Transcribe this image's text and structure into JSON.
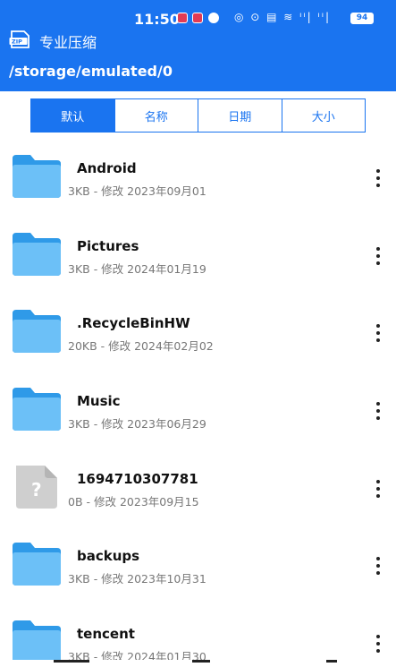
{
  "status": {
    "time": "11:50",
    "icons_text": "◎ ⊙ ▤ ≋ ᴵᴵ| ᴵᴵ|",
    "battery": "94"
  },
  "app": {
    "title": "专业压缩",
    "path": "/storage/emulated/0",
    "accent": "#1a74f0"
  },
  "sort_tabs": [
    {
      "label": "默认",
      "active": true
    },
    {
      "label": "名称",
      "active": false
    },
    {
      "label": "日期",
      "active": false
    },
    {
      "label": "大小",
      "active": false
    }
  ],
  "files": [
    {
      "name": "Android",
      "meta": "3KB - 修改 2023年09月01",
      "icon": "folder-icon"
    },
    {
      "name": "Pictures",
      "meta": "3KB - 修改 2024年01月19",
      "icon": "folder-icon"
    },
    {
      "name": ".RecycleBinHW",
      "meta": "20KB - 修改 2024年02月02",
      "icon": "folder-icon"
    },
    {
      "name": "Music",
      "meta": "3KB - 修改 2023年06月29",
      "icon": "folder-icon"
    },
    {
      "name": "1694710307781",
      "meta": "0B - 修改 2023年09月15",
      "icon": "unknown-file-icon"
    },
    {
      "name": "backups",
      "meta": "3KB - 修改 2023年10月31",
      "icon": "folder-icon"
    },
    {
      "name": "tencent",
      "meta": "3KB - 修改 2024年01月30",
      "icon": "folder-icon"
    }
  ]
}
